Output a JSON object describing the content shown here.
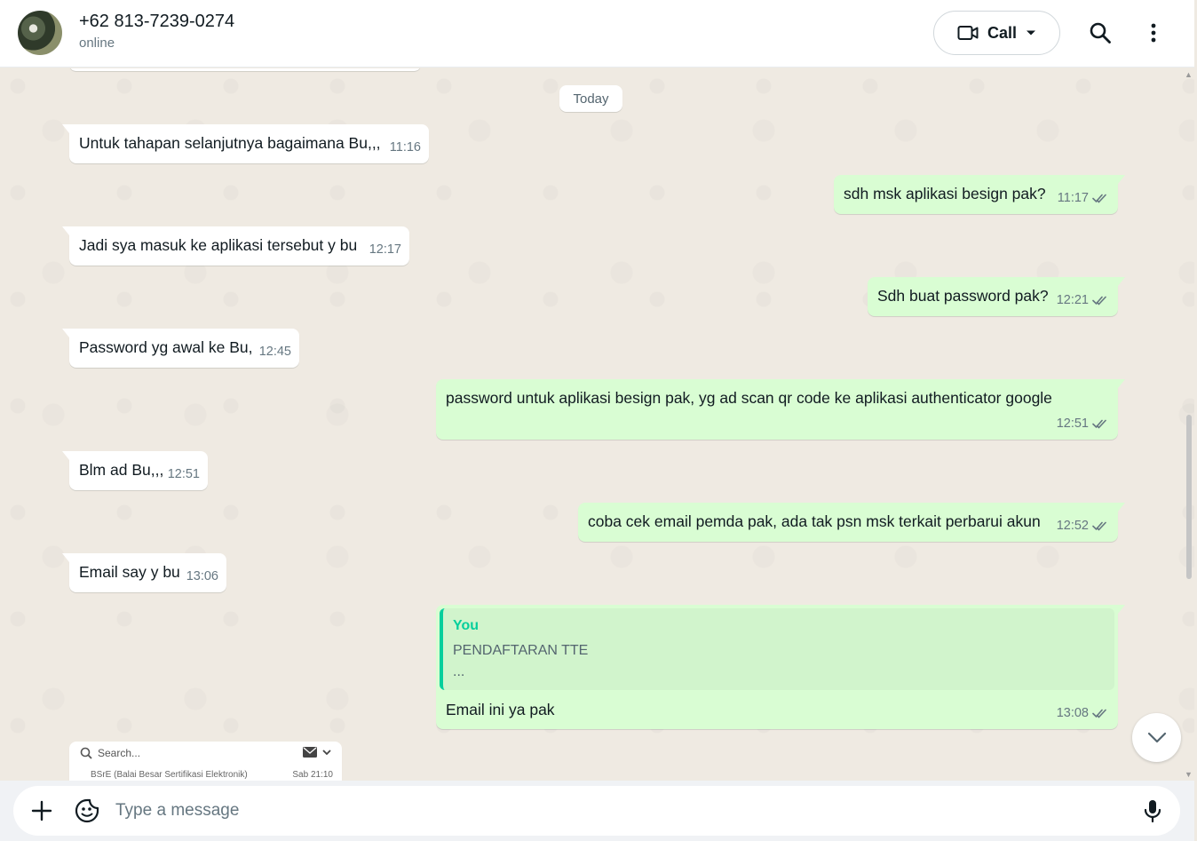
{
  "header": {
    "contact_name": "+62 813-7239-0274",
    "status": "online",
    "call_label": "Call",
    "icons": [
      "video-camera-icon",
      "chevron-down-icon",
      "search-icon",
      "menu-dots-icon"
    ]
  },
  "chat": {
    "date_divider": "Today",
    "messages": [
      {
        "direction": "in",
        "text": "Untuk tahapan selanjutnya bagaimana Bu,,,",
        "time": "11:16"
      },
      {
        "direction": "out",
        "text": "sdh msk aplikasi besign pak?",
        "time": "11:17",
        "status": "read"
      },
      {
        "direction": "in",
        "text": "Jadi sya masuk ke aplikasi tersebut y bu",
        "time": "12:17"
      },
      {
        "direction": "out",
        "text": "Sdh buat password pak?",
        "time": "12:21",
        "status": "read"
      },
      {
        "direction": "in",
        "text": "Password yg awal ke Bu,",
        "time": "12:45"
      },
      {
        "direction": "out",
        "text": "password untuk aplikasi besign pak, yg ad scan qr code ke aplikasi authenticator google",
        "time": "12:51",
        "status": "read"
      },
      {
        "direction": "in",
        "text": "Blm ad Bu,,,",
        "time": "12:51"
      },
      {
        "direction": "out",
        "text": "coba cek email pemda pak, ada tak psn msk terkait perbarui akun",
        "time": "12:52",
        "status": "read"
      },
      {
        "direction": "in",
        "text": "Email say y bu",
        "time": "13:06"
      },
      {
        "direction": "out",
        "text": "Email ini ya pak",
        "time": "13:08",
        "status": "read",
        "quote": {
          "author": "You",
          "text": "PENDAFTARAN TTE",
          "more": "..."
        }
      }
    ],
    "image_preview": {
      "search_placeholder": "Search...",
      "row_sender": "BSrE (Balai Besar Sertifikasi Elektronik)",
      "row_time": "Sab 21:10"
    }
  },
  "composer": {
    "placeholder": "Type a message",
    "icons": [
      "plus-icon",
      "sticker-icon",
      "mic-icon"
    ]
  },
  "colors": {
    "incoming_bubble": "#ffffff",
    "outgoing_bubble": "#d9fdd3",
    "chat_background": "#efeae2",
    "read_ticks": "#667781",
    "quote_accent": "#06cf9c"
  }
}
